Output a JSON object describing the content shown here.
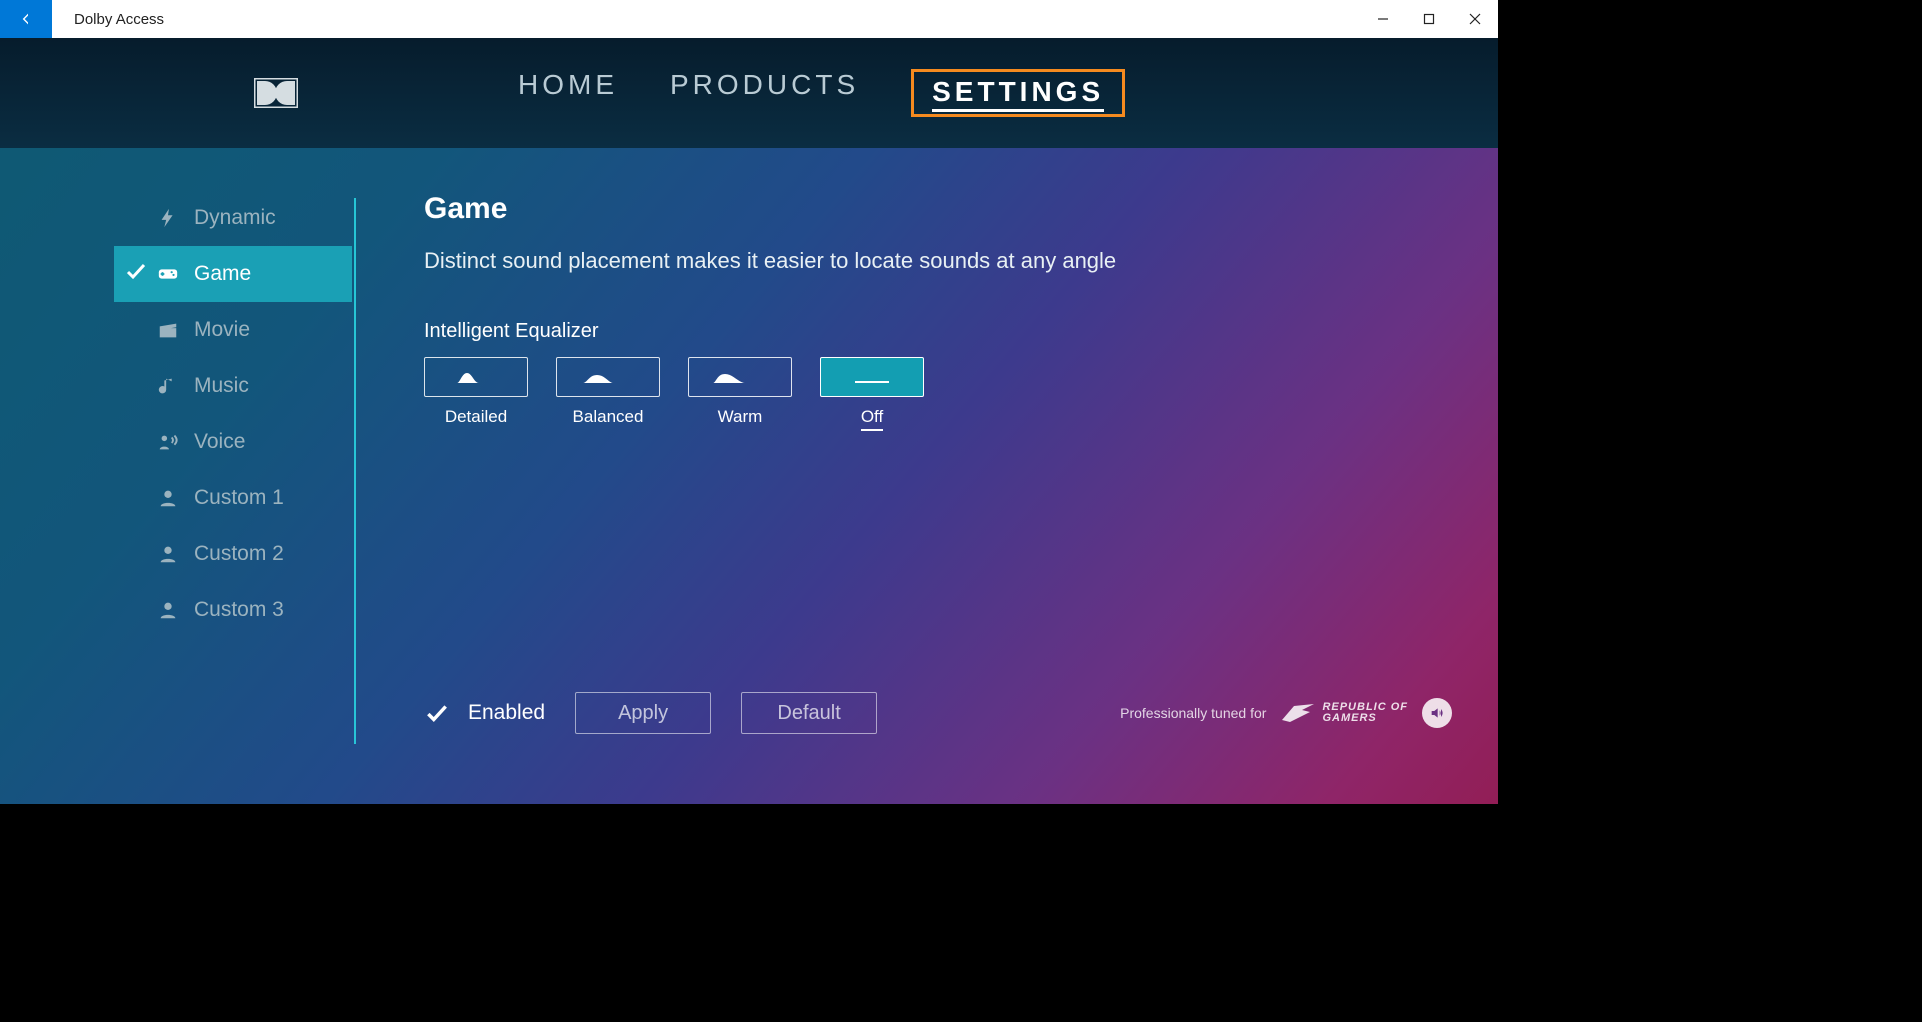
{
  "window": {
    "title": "Dolby Access"
  },
  "nav": {
    "items": [
      {
        "label": "HOME",
        "active": false
      },
      {
        "label": "PRODUCTS",
        "active": false
      },
      {
        "label": "SETTINGS",
        "active": true
      }
    ]
  },
  "sidebar": {
    "items": [
      {
        "label": "Dynamic",
        "icon": "bolt"
      },
      {
        "label": "Game",
        "icon": "gamepad",
        "active": true,
        "checked": true
      },
      {
        "label": "Movie",
        "icon": "clapper"
      },
      {
        "label": "Music",
        "icon": "note"
      },
      {
        "label": "Voice",
        "icon": "voice"
      },
      {
        "label": "Custom 1",
        "icon": "person"
      },
      {
        "label": "Custom 2",
        "icon": "person"
      },
      {
        "label": "Custom 3",
        "icon": "person"
      }
    ]
  },
  "content": {
    "title": "Game",
    "description": "Distinct sound placement makes it easier to locate sounds at any angle",
    "eq_label": "Intelligent Equalizer",
    "eq_options": [
      {
        "label": "Detailed"
      },
      {
        "label": "Balanced"
      },
      {
        "label": "Warm"
      },
      {
        "label": "Off",
        "selected": true
      }
    ]
  },
  "footer": {
    "enabled_label": "Enabled",
    "apply_label": "Apply",
    "default_label": "Default",
    "tuned_label": "Professionally tuned for",
    "partner_line1": "REPUBLIC OF",
    "partner_line2": "GAMERS"
  }
}
